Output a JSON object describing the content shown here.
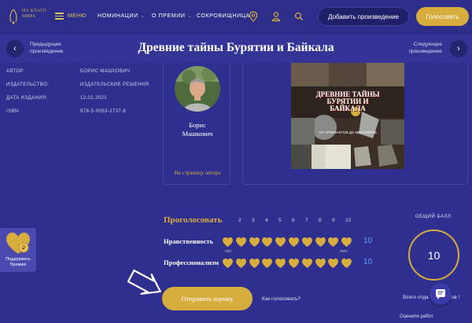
{
  "header": {
    "logo_text": [
      "НА БЛАГО",
      "МИРА"
    ],
    "menu_label": "МЕНЮ",
    "nav": [
      {
        "label": "НОМИНАЦИИ",
        "has_dropdown": true
      },
      {
        "label": "О ПРЕМИИ",
        "has_dropdown": true
      },
      {
        "label": "СОКРОВИЩНИЦА",
        "has_dropdown": false
      }
    ],
    "add_work_label": "Добавить произведение",
    "vote_label": "Голосовать"
  },
  "titlebar": {
    "prev_label": [
      "Предыдущее",
      "произведение"
    ],
    "next_label": [
      "Следующее",
      "произведение"
    ],
    "title": "Древние тайны Бурятии и Байкала"
  },
  "book_meta": [
    {
      "key": "АВТОР:",
      "value": "БОРИС МАШКОВИЧ"
    },
    {
      "key": "ИЗДАТЕЛЬСТВО:",
      "value": "ИЗДАТЕЛЬСКИЕ РЕШЕНИЯ"
    },
    {
      "key": "ДАТА ИЗДАНИЯ:",
      "value": "12.02.2021"
    },
    {
      "key": "ISBN:",
      "value": "978-5-0053-2737-6"
    }
  ],
  "author": {
    "name_lines": [
      "Борис",
      "Машкович"
    ],
    "link": "На страницу автора"
  },
  "cover": {
    "title_lines": [
      "ДРЕВНИЕ ТАЙНЫ",
      "БУРЯТИИ И",
      "БАЙКАЛА"
    ],
    "subtitle": "ОТ АРТЕФАКТОВ ДО МЕГАЛИТОВ"
  },
  "voting": {
    "heading": "Проголосовать",
    "scale": [
      "2",
      "3",
      "4",
      "5",
      "6",
      "7",
      "8",
      "9",
      "10"
    ],
    "min_label": "min",
    "max_label": "max",
    "rows": [
      {
        "label": "Нравственность",
        "score": "10",
        "hearts_filled": 10
      },
      {
        "label": "Профессионализм",
        "score": "10",
        "hearts_filled": 10
      }
    ],
    "submit_label": "Отправить оценку",
    "how_label": "Как голосовать?"
  },
  "total": {
    "label": "ОБЩИЙ БАЛЛ",
    "value": "10",
    "works_label": "Всего отда",
    "works_suffix": "сов !",
    "ratings_label": "Оценили работ"
  },
  "support": {
    "label_lines": [
      "Поддержать",
      "Премию"
    ]
  },
  "colors": {
    "background": "#2f2f8f",
    "gold": "#d7ad3d",
    "score_blue": "#5aa0ff"
  }
}
